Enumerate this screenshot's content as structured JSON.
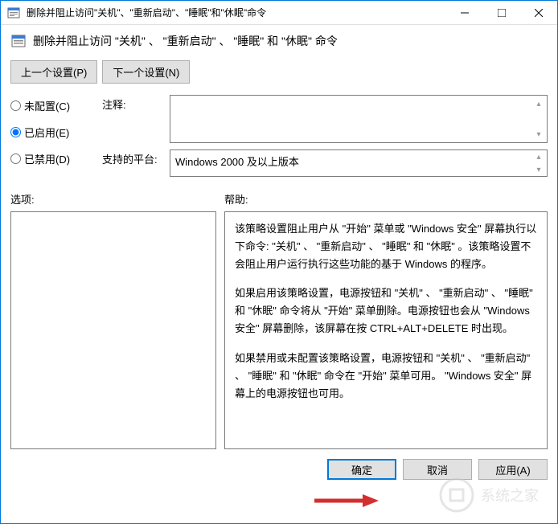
{
  "titlebar": {
    "title": "删除并阻止访问\"关机\"、\"重新启动\"、\"睡眠\"和\"休眠\"命令"
  },
  "header": {
    "text": "删除并阻止访问 \"关机\" 、 \"重新启动\" 、 \"睡眠\" 和 \"休眠\" 命令"
  },
  "nav": {
    "prev": "上一个设置(P)",
    "next": "下一个设置(N)"
  },
  "radios": {
    "not_configured": "未配置(C)",
    "enabled": "已启用(E)",
    "disabled": "已禁用(D)",
    "selected": "enabled"
  },
  "fields": {
    "comment_label": "注释:",
    "comment_value": "",
    "platform_label": "支持的平台:",
    "platform_value": "Windows 2000 及以上版本"
  },
  "labels": {
    "options": "选项:",
    "help": "帮助:"
  },
  "help": {
    "p1": "该策略设置阻止用户从 \"开始\" 菜单或 \"Windows 安全\" 屏幕执行以下命令: \"关机\" 、 \"重新启动\" 、 \"睡眠\" 和 \"休眠\" 。该策略设置不会阻止用户运行执行这些功能的基于 Windows 的程序。",
    "p2": "如果启用该策略设置，电源按钮和 \"关机\" 、 \"重新启动\" 、 \"睡眠\" 和 \"休眠\" 命令将从 \"开始\" 菜单删除。电源按钮也会从 \"Windows 安全\" 屏幕删除，该屏幕在按 CTRL+ALT+DELETE 时出现。",
    "p3": "如果禁用或未配置该策略设置，电源按钮和 \"关机\" 、 \"重新启动\" 、 \"睡眠\" 和 \"休眠\" 命令在 \"开始\" 菜单可用。 \"Windows 安全\" 屏幕上的电源按钮也可用。"
  },
  "buttons": {
    "ok": "确定",
    "cancel": "取消",
    "apply": "应用(A)"
  },
  "watermark": "系统之家"
}
